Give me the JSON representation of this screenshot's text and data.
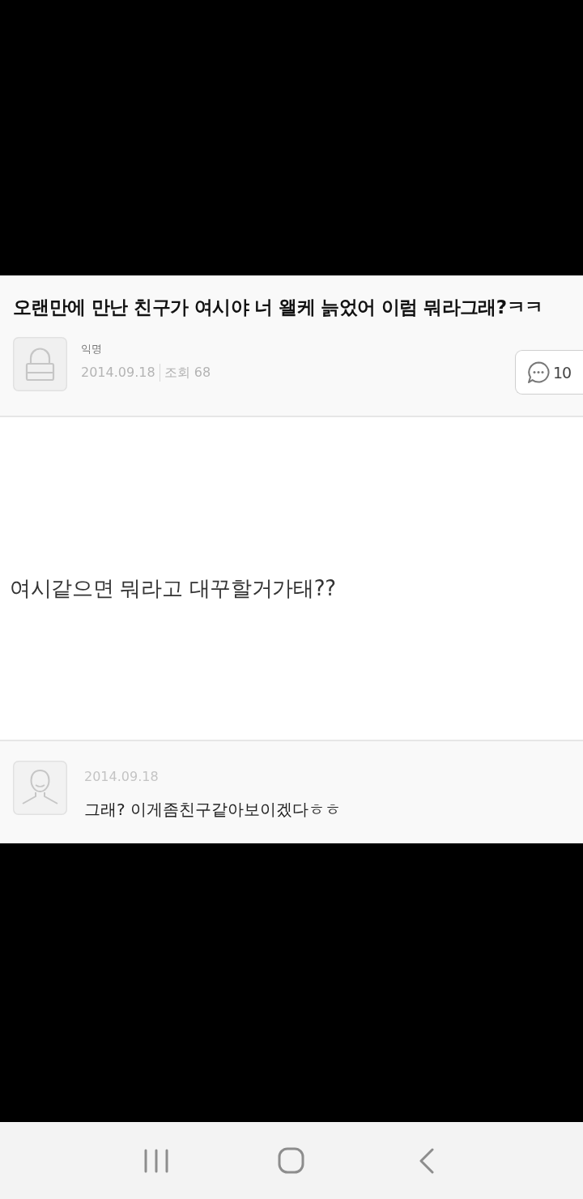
{
  "post": {
    "title": "오랜만에 만난 친구가 여시야 너 왤케 늙었어 이럼 뭐라그래?ㅋㅋ",
    "author": "익명",
    "date": "2014.09.18",
    "views": "조회 68",
    "comment_count": "10",
    "body": "여시같으면 뭐라고 대꾸할거가태??"
  },
  "comments": [
    {
      "date": "2014.09.18",
      "text": "그래? 이게좀친구같아보이겠다ㅎㅎ"
    }
  ]
}
